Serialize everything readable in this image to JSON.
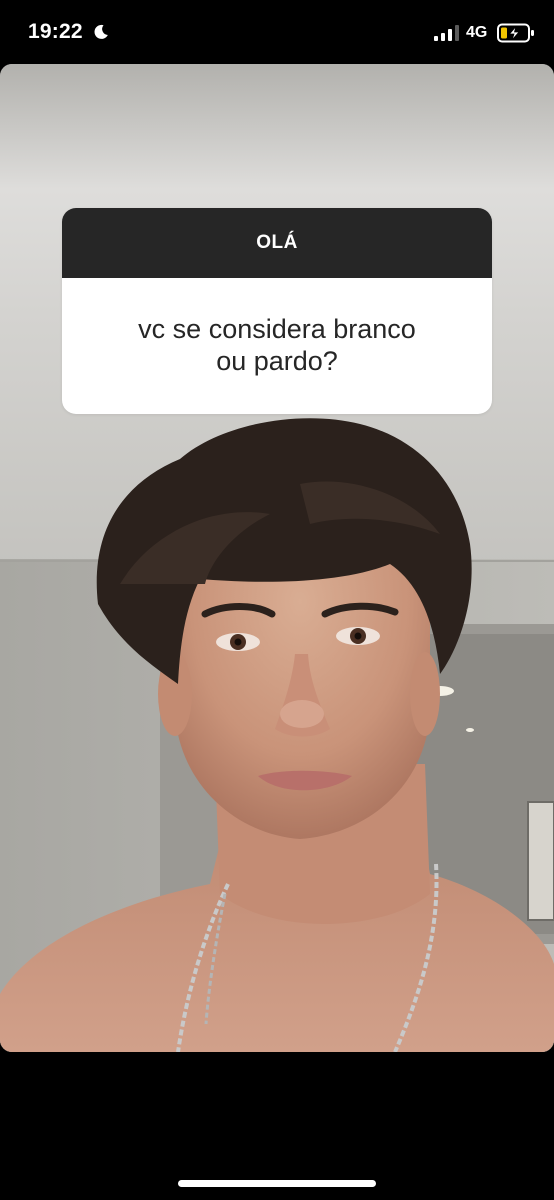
{
  "status_bar": {
    "time": "19:22",
    "network": "4G",
    "icons": [
      "moon-icon",
      "signal-icon",
      "battery-charging-icon"
    ]
  },
  "story": {
    "question_sticker": {
      "header": "OLÁ",
      "question": "vc se considera branco ou pardo?"
    },
    "photo": {
      "icon": "selfie-photo"
    }
  },
  "colors": {
    "sticker_header": "#262626",
    "sticker_body": "#ffffff",
    "background": "#000000"
  }
}
